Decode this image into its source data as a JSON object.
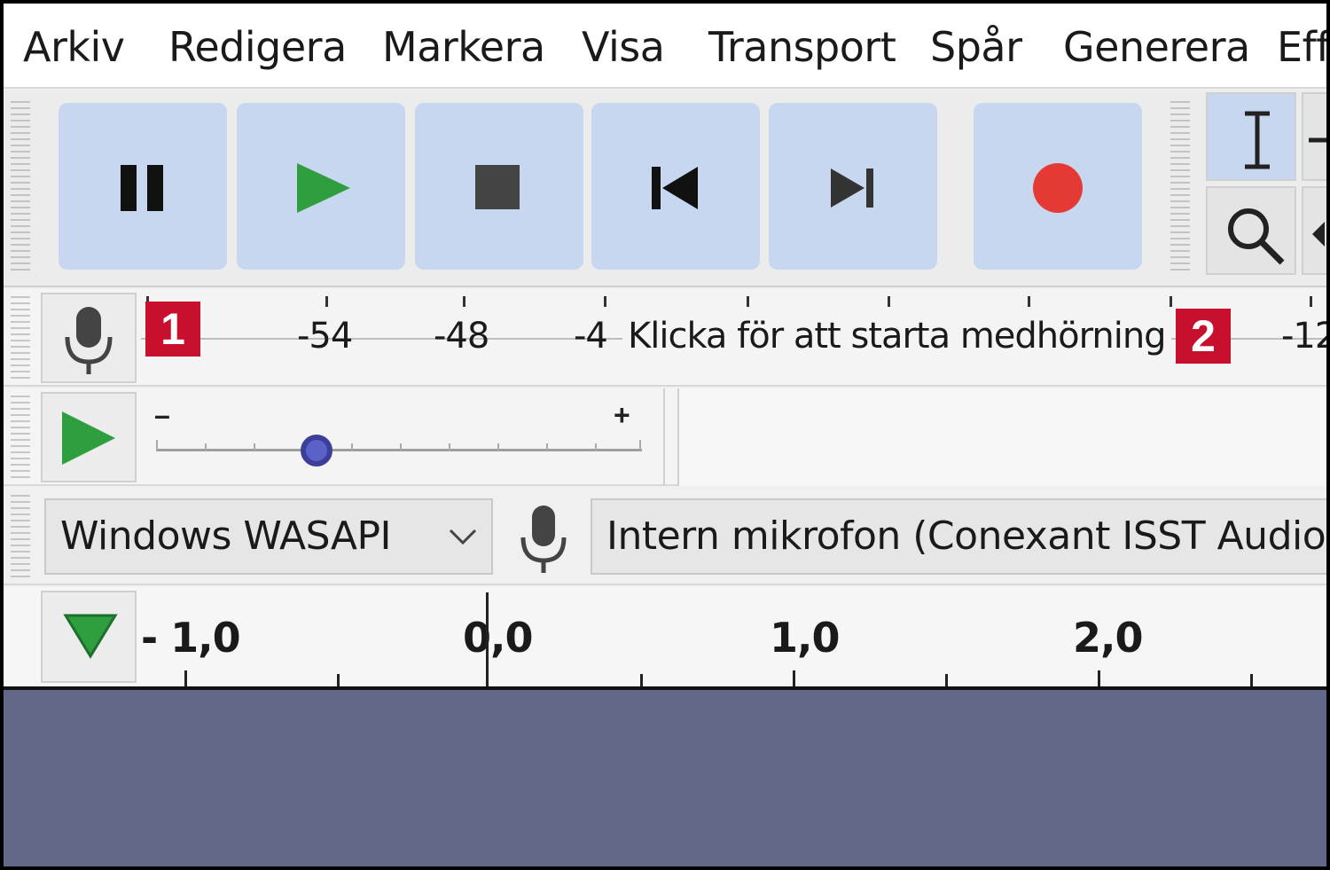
{
  "menu": {
    "items": [
      "Arkiv",
      "Redigera",
      "Markera",
      "Visa",
      "Transport",
      "Spår",
      "Generera",
      "Eff"
    ]
  },
  "transport": {
    "buttons": [
      "pause-icon",
      "play-icon",
      "stop-icon",
      "skip-to-start-icon",
      "skip-to-end-icon",
      "record-icon"
    ],
    "colors": {
      "button_bg": "#c7d7ef",
      "play": "#2e9e3e",
      "record": "#e53935"
    }
  },
  "tools": [
    "selection-tool-icon",
    "zoom-tool-icon"
  ],
  "recording_meter": {
    "ticks": [
      "-54",
      "-48",
      "-4",
      "-12"
    ],
    "hint": "Klicka för att starta medhörning"
  },
  "callouts": [
    "1",
    "2"
  ],
  "playback_slider": {
    "min_label": "–",
    "max_label": "+",
    "value_fraction": 0.33
  },
  "devices": {
    "host": "Windows WASAPI",
    "input": "Intern mikrofon (Conexant ISST Audio)"
  },
  "timeline": {
    "labels": [
      "- 1,0",
      "0,0",
      "1,0",
      "2,0"
    ]
  }
}
